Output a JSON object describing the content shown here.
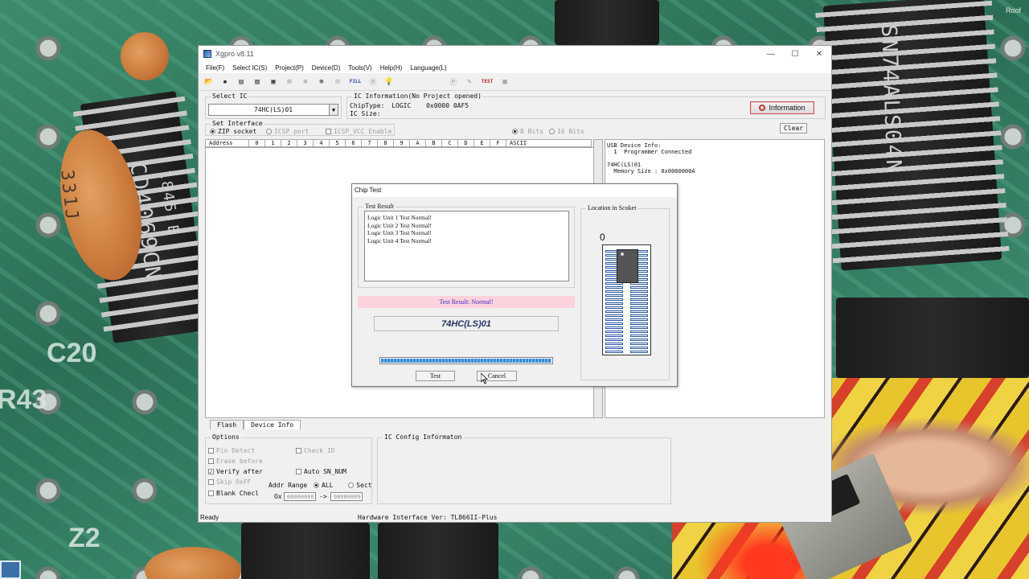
{
  "background": {
    "roof_label": "Roof",
    "chip_texts": [
      "SN74ALS04N",
      "CD4069CN",
      "1845 B"
    ],
    "board_labels": [
      "C20",
      "R43",
      "Z2"
    ],
    "cap_label": "331J"
  },
  "window": {
    "title": "Xgpro v8.11",
    "controls": [
      "—",
      "☐",
      "✕"
    ],
    "menu": [
      "File(F)",
      "Select IC(S)",
      "Project(P)",
      "Device(D)",
      "Tools(V)",
      "Help(H)",
      "Language(L)"
    ]
  },
  "toolbar": {
    "icons": [
      "open-icon",
      "save-icon",
      "print-icon",
      "save-as-icon",
      "chip-icon",
      "read-icon",
      "verify-icon",
      "write-icon",
      "blank-icon",
      "fill-icon",
      "protect-icon",
      "bulb-icon",
      "project-icon",
      "edit-icon",
      "test-icon",
      "socket-icon"
    ],
    "fill_label": "FILL",
    "test_label": "TEST"
  },
  "select_ic": {
    "title": "Select IC",
    "value": "74HC(LS)01"
  },
  "ic_information": {
    "title": "IC Information(No Project opened)",
    "chip_type_label": "ChipType:",
    "chip_type_value": "LOGIC",
    "checksum": "0x0000 0AF5",
    "ic_size_label": "IC Size:"
  },
  "information_button": "Information",
  "clear_button": "Clear",
  "interface": {
    "title": "Set Interface",
    "zip_socket": "ZIP socket",
    "icsp_port": "ICSP port",
    "icsp_vcc": "ICSP_VCC Enable",
    "bits8": "8 Bits",
    "bits16": "16 Bits"
  },
  "hex_header": [
    "Address",
    "0",
    "1",
    "2",
    "3",
    "4",
    "5",
    "6",
    "7",
    "8",
    "9",
    "A",
    "B",
    "C",
    "D",
    "E",
    "F",
    "ASCII"
  ],
  "usb_info": "USB Device Info:\n  1  Programmer Connected\n\n74HC(LS)01\n  Memory Size : 0x0000000A",
  "tabs": [
    "Flash",
    "Device Info"
  ],
  "options": {
    "title": "Options",
    "pin_detect": "Pin Detect",
    "erase_before": "Erase before",
    "verify_after": "Verify after",
    "skip_offf": "Skip OxFF",
    "blank_check": "Blank Checl",
    "check_id": "Check ID",
    "auto_sn": "Auto SN_NUM",
    "addr_range": "Addr Range",
    "all": "ALL",
    "sect": "Sect",
    "ox": "Ox",
    "addr_from": "00000000",
    "arrow": "->",
    "addr_to": "00000009"
  },
  "ic_config": {
    "title": "IC Config Informaton"
  },
  "status": {
    "ready": "Ready",
    "hardware": "Hardware Interface Ver: TL866II-Plus"
  },
  "dialog": {
    "title": "Chip Test",
    "test_result_title": "Test Result",
    "results": [
      "Logic Unit 1 Test Normal!",
      "Logic Unit 2 Test Normal!",
      "Logic Unit 3 Test Normal!",
      "Logic Unit 4 Test Normal!"
    ],
    "result_summary": "Test Result:  Normal!",
    "chip_name": "74HC(LS)01",
    "progress": 1.0,
    "test_button": "Test",
    "cancel_button": "Cancel",
    "location_title": "Location in Scoket",
    "socket_index": "0"
  }
}
